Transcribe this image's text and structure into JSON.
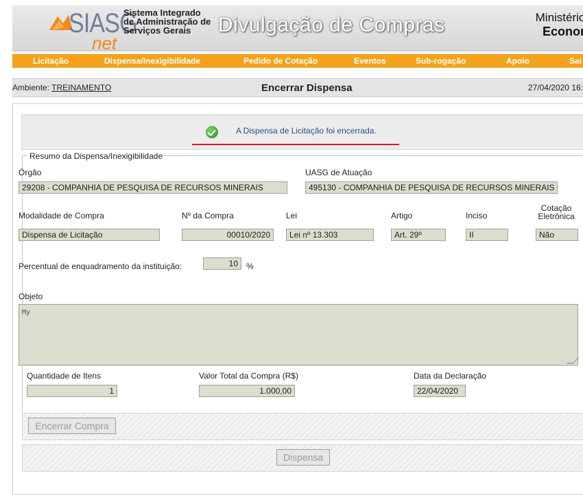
{
  "header": {
    "logo_text": "SIASG",
    "logo_sub": "net",
    "system_name": "Sistema Integrado de Administração de Serviços Gerais",
    "banner_title": "Divulgação de Compras",
    "ministry_line1": "Ministério da",
    "ministry_line2": "Economia"
  },
  "nav": {
    "items": [
      "Licitação",
      "Dispensa/Inexigibilidade",
      "Pedido de Cotação",
      "Eventos",
      "Sub-rogação",
      "Apoio",
      "Sai"
    ]
  },
  "env": {
    "label": "Ambiente:",
    "value": "TREINAMENTO",
    "page_title": "Encerrar Dispensa",
    "datetime": "27/04/2020 16:"
  },
  "message": {
    "text": "A Dispensa de Licitação foi encerrada."
  },
  "summary": {
    "legend": "Resumo da Dispensa/Inexigibilidade",
    "orgao_label": "Órgão",
    "orgao_value": "29208 - COMPANHIA DE PESQUISA DE RECURSOS MINERAIS",
    "uasg_label": "UASG de Atuação",
    "uasg_value": "495130 - COMPANHIA DE PESQUISA DE RECURSOS MINERAIS",
    "modalidade_label": "Modalidade de Compra",
    "modalidade_value": "Dispensa de Licitação",
    "numero_label": "Nº da Compra",
    "numero_value": "00010/2020",
    "lei_label": "Lei",
    "lei_value": "Lei nº 13.303",
    "artigo_label": "Artigo",
    "artigo_value": "Art. 29º",
    "inciso_label": "Inciso",
    "inciso_value": "II",
    "cotacao_label_1": "Cotação",
    "cotacao_label_2": "Eletrônica",
    "cotacao_value": "Não",
    "percentual_label": "Percentual de enquadramento da instituição:",
    "percentual_value": "10",
    "percentual_unit": "%",
    "objeto_label": "Objeto",
    "objeto_value": "My",
    "quantidade_label": "Quantidade de Itens",
    "quantidade_value": "1",
    "valor_label": "Valor Total da Compra (R$)",
    "valor_value": "1.000,00",
    "data_label": "Data da Declaração",
    "data_value": "22/04/2020"
  },
  "buttons": {
    "encerrar": "Encerrar Compra",
    "dispensa": "Dispensa"
  },
  "colors": {
    "nav_orange": "#f4a21a",
    "field_bg": "#dcdccf",
    "alert_underline": "#e0191c",
    "message_text": "#2a4f8a"
  }
}
